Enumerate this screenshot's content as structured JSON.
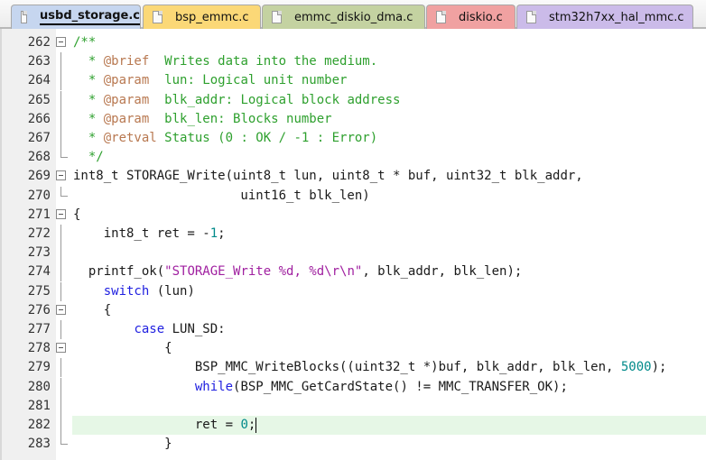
{
  "tabs": [
    {
      "label": "usbd_storage.c",
      "color": "#c6d6ef",
      "active": true
    },
    {
      "label": "bsp_emmc.c",
      "color": "#fbd877"
    },
    {
      "label": "emmc_diskio_dma.c",
      "color": "#c4d2a1"
    },
    {
      "label": "diskio.c",
      "color": "#f0a1a1"
    },
    {
      "label": "stm32h7xx_hal_mmc.c",
      "color": "#cbbbe9"
    }
  ],
  "colors": {
    "text": "#1a1a1a",
    "comment": "#2ea02e",
    "doctag": "#b87850",
    "keyword": "#2020e0",
    "string": "#a020a0",
    "number": "#008a8a",
    "highlight": "#e6f7e6"
  },
  "lines": [
    {
      "n": "262",
      "fold": "open",
      "segs": [
        {
          "t": "/**",
          "c": "comment"
        }
      ]
    },
    {
      "n": "263",
      "fold": "bar",
      "segs": [
        {
          "t": "  * ",
          "c": "comment"
        },
        {
          "t": "@brief",
          "c": "doctag"
        },
        {
          "t": "  Writes data into the medium.",
          "c": "comment"
        }
      ]
    },
    {
      "n": "264",
      "fold": "bar",
      "segs": [
        {
          "t": "  * ",
          "c": "comment"
        },
        {
          "t": "@param",
          "c": "doctag"
        },
        {
          "t": "  lun: Logical unit number",
          "c": "comment"
        }
      ]
    },
    {
      "n": "265",
      "fold": "bar",
      "segs": [
        {
          "t": "  * ",
          "c": "comment"
        },
        {
          "t": "@param",
          "c": "doctag"
        },
        {
          "t": "  blk_addr: Logical block address",
          "c": "comment"
        }
      ]
    },
    {
      "n": "266",
      "fold": "bar",
      "segs": [
        {
          "t": "  * ",
          "c": "comment"
        },
        {
          "t": "@param",
          "c": "doctag"
        },
        {
          "t": "  blk_len: Blocks number",
          "c": "comment"
        }
      ]
    },
    {
      "n": "267",
      "fold": "bar",
      "segs": [
        {
          "t": "  * ",
          "c": "comment"
        },
        {
          "t": "@retval",
          "c": "doctag"
        },
        {
          "t": " Status (0 : OK / -1 : Error)",
          "c": "comment"
        }
      ]
    },
    {
      "n": "268",
      "fold": "end",
      "segs": [
        {
          "t": "  */",
          "c": "comment"
        }
      ]
    },
    {
      "n": "269",
      "fold": "open",
      "segs": [
        {
          "t": "int8_t STORAGE_Write(uint8_t lun, uint8_t * buf, uint32_t blk_addr,",
          "c": "text"
        }
      ]
    },
    {
      "n": "270",
      "fold": "end",
      "segs": [
        {
          "t": "                      uint16_t blk_len)",
          "c": "text"
        }
      ]
    },
    {
      "n": "271",
      "fold": "open",
      "segs": [
        {
          "t": "{",
          "c": "text"
        }
      ]
    },
    {
      "n": "272",
      "fold": "bar",
      "segs": [
        {
          "t": "    int8_t ret = -",
          "c": "text"
        },
        {
          "t": "1",
          "c": "number"
        },
        {
          "t": ";",
          "c": "text"
        }
      ]
    },
    {
      "n": "273",
      "fold": "bar",
      "segs": []
    },
    {
      "n": "274",
      "fold": "bar",
      "segs": [
        {
          "t": "  printf_ok(",
          "c": "text"
        },
        {
          "t": "\"STORAGE_Write %d, %d\\r\\n\"",
          "c": "string"
        },
        {
          "t": ", blk_addr, blk_len);",
          "c": "text"
        }
      ]
    },
    {
      "n": "275",
      "fold": "bar",
      "segs": [
        {
          "t": "    ",
          "c": "text"
        },
        {
          "t": "switch",
          "c": "keyword"
        },
        {
          "t": " (lun)",
          "c": "text"
        }
      ]
    },
    {
      "n": "276",
      "fold": "open",
      "segs": [
        {
          "t": "    {",
          "c": "text"
        }
      ]
    },
    {
      "n": "277",
      "fold": "bar",
      "segs": [
        {
          "t": "        ",
          "c": "text"
        },
        {
          "t": "case",
          "c": "keyword"
        },
        {
          "t": " LUN_SD:",
          "c": "text"
        }
      ]
    },
    {
      "n": "278",
      "fold": "open",
      "segs": [
        {
          "t": "            {",
          "c": "text"
        }
      ]
    },
    {
      "n": "279",
      "fold": "bar",
      "segs": [
        {
          "t": "                BSP_MMC_WriteBlocks((uint32_t *)buf, blk_addr, blk_len, ",
          "c": "text"
        },
        {
          "t": "5000",
          "c": "number"
        },
        {
          "t": ");",
          "c": "text"
        }
      ]
    },
    {
      "n": "280",
      "fold": "bar",
      "segs": [
        {
          "t": "                ",
          "c": "text"
        },
        {
          "t": "while",
          "c": "keyword"
        },
        {
          "t": "(BSP_MMC_GetCardState() != MMC_TRANSFER_OK);",
          "c": "text"
        }
      ]
    },
    {
      "n": "281",
      "fold": "bar",
      "segs": []
    },
    {
      "n": "282",
      "fold": "bar",
      "highlight": true,
      "caret": true,
      "segs": [
        {
          "t": "                ret = ",
          "c": "text"
        },
        {
          "t": "0",
          "c": "number"
        },
        {
          "t": ";",
          "c": "text"
        }
      ]
    },
    {
      "n": "283",
      "fold": "end",
      "segs": [
        {
          "t": "            }",
          "c": "text"
        }
      ]
    }
  ]
}
